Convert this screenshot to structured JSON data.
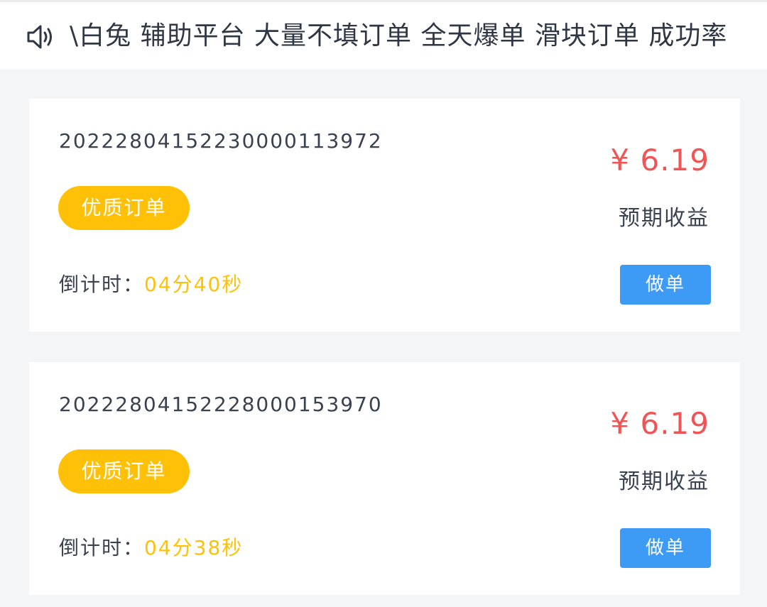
{
  "notice": {
    "icon": "speaker-icon",
    "text": "\\白兔 辅助平台 大量不填订单 全天爆单 滑块订单 成功率"
  },
  "orders": [
    {
      "order_no": "20222804152230000113972",
      "badge": "优质订单",
      "price": "¥ 6.19",
      "earnings_label": "预期收益",
      "countdown_label": "倒计时：",
      "countdown_value": "04分40秒",
      "action_label": "做单"
    },
    {
      "order_no": "20222804152228000153970",
      "badge": "优质订单",
      "price": "¥ 6.19",
      "earnings_label": "预期收益",
      "countdown_label": "倒计时：",
      "countdown_value": "04分38秒",
      "action_label": "做单"
    }
  ],
  "colors": {
    "price": "#f05454",
    "badge": "#ffc107",
    "countdown_value": "#ffc107",
    "action_button": "#3d9af5",
    "background": "#f4f5f7"
  }
}
